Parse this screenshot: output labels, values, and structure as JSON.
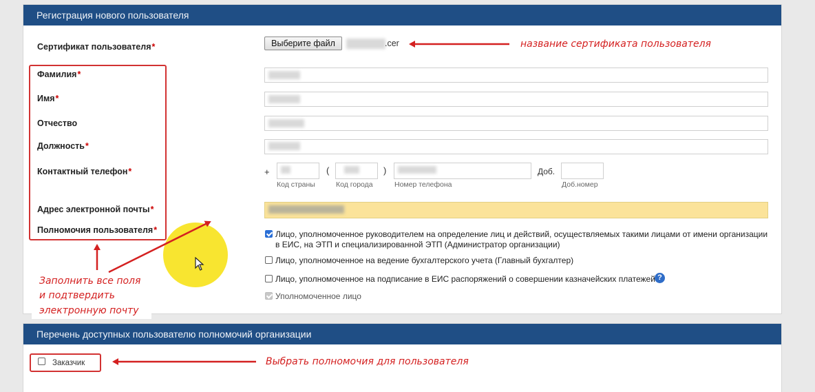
{
  "registration": {
    "header": "Регистрация нового пользователя",
    "certificate_label": "Сертификат пользователя",
    "file_button": "Выберите файл",
    "file_name": ".cer",
    "fields": {
      "last_name": "Фамилия",
      "first_name": "Имя",
      "patronymic": "Отчество",
      "position": "Должность",
      "phone": "Контактный телефон",
      "email": "Адрес электронной почты",
      "authority": "Полномочия пользователя"
    },
    "required_mark": "*",
    "phone_parts": {
      "plus": "+",
      "open_paren": "(",
      "close_paren": ")",
      "ext_label": "Доб.",
      "country_caption": "Код страны",
      "city_caption": "Код города",
      "number_caption": "Номер телефона",
      "ext_caption": "Доб.номер"
    },
    "authority_options": [
      {
        "label": "Лицо, уполномоченное руководителем на определение лиц и действий, осуществляемых такими лицами от имени организации в ЕИС, на ЭТП и специализированной ЭТП (Администратор организации)",
        "checked": true
      },
      {
        "label": "Лицо, уполномоченное на ведение бухгалтерского учета (Главный бухгалтер)",
        "checked": false
      },
      {
        "label": "Лицо, уполномоченное на подписание в ЕИС распоряжений о совершении казначейских платежей",
        "checked": false
      },
      {
        "label": "Уполномоченное лицо",
        "checked": true,
        "disabled": true
      }
    ],
    "help_icon": "?"
  },
  "permissions": {
    "header": "Перечень доступных пользователю полномочий организации",
    "options": [
      {
        "label": "Заказчик",
        "checked": false
      }
    ]
  },
  "annotations": {
    "certificate_name": "название сертификата пользователя",
    "fill_fields": [
      "Заполнить все поля",
      "и подтвердить",
      "электронную почту"
    ],
    "select_permissions": "Выбрать полномочия для пользователя"
  },
  "colors": {
    "header_bg": "#1f4e85",
    "annotation_red": "#d42020",
    "required_red": "#cc0000",
    "email_highlight": "#fbe39a",
    "cursor_highlight": "#f7e21a"
  }
}
